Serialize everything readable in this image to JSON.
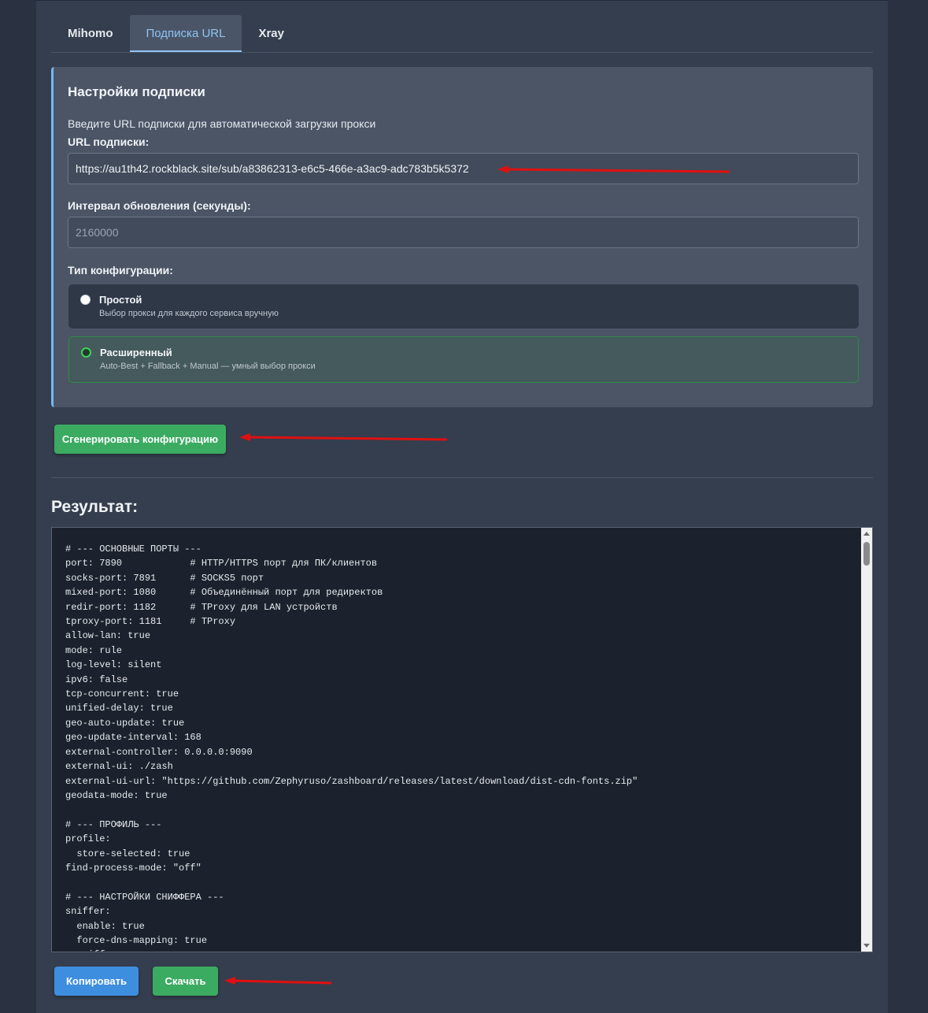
{
  "tabs": [
    {
      "label": "Mihomo"
    },
    {
      "label": "Подписка URL"
    },
    {
      "label": "Xray"
    }
  ],
  "settings": {
    "title": "Настройки подписки",
    "description": "Введите URL подписки для автоматической загрузки прокси",
    "url_label": "URL подписки:",
    "url_value": "https://au1th42.rockblack.site/sub/a83862313-e6c5-466e-a3ac9-adc783b5k5372",
    "interval_label": "Интервал обновления (секунды):",
    "interval_placeholder": "2160000",
    "config_type_label": "Тип конфигурации:",
    "options": [
      {
        "title": "Простой",
        "subtitle": "Выбор прокси для каждого сервиса вручную",
        "selected": false
      },
      {
        "title": "Расширенный",
        "subtitle": "Auto-Best + Fallback + Manual — умный выбор прокси",
        "selected": true
      }
    ]
  },
  "generate_button": "Сгенерировать конфигурацию",
  "result": {
    "title": "Результат:",
    "code": "# --- ОСНОВНЫЕ ПОРТЫ ---\nport: 7890            # HTTP/HTTPS порт для ПК/клиентов\nsocks-port: 7891      # SOCKS5 порт\nmixed-port: 1080      # Объединённый порт для редиректов\nredir-port: 1182      # TProxy для LAN устройств\ntproxy-port: 1181     # TProxy\nallow-lan: true\nmode: rule\nlog-level: silent\nipv6: false\ntcp-concurrent: true\nunified-delay: true\ngeo-auto-update: true\ngeo-update-interval: 168\nexternal-controller: 0.0.0.0:9090\nexternal-ui: ./zash\nexternal-ui-url: \"https://github.com/Zephyruso/zashboard/releases/latest/download/dist-cdn-fonts.zip\"\ngeodata-mode: true\n\n# --- ПРОФИЛЬ ---\nprofile:\n  store-selected: true\nfind-process-mode: \"off\"\n\n# --- НАСТРОЙКИ СНИФФЕРА ---\nsniffer:\n  enable: true\n  force-dns-mapping: true\n  sniff:"
  },
  "buttons": {
    "copy": "Копировать",
    "download": "Скачать"
  },
  "colors": {
    "accent_blue": "#8fc3f2",
    "green": "#3cab62",
    "blue": "#3e8ee0",
    "annotation_red": "#e01010"
  }
}
